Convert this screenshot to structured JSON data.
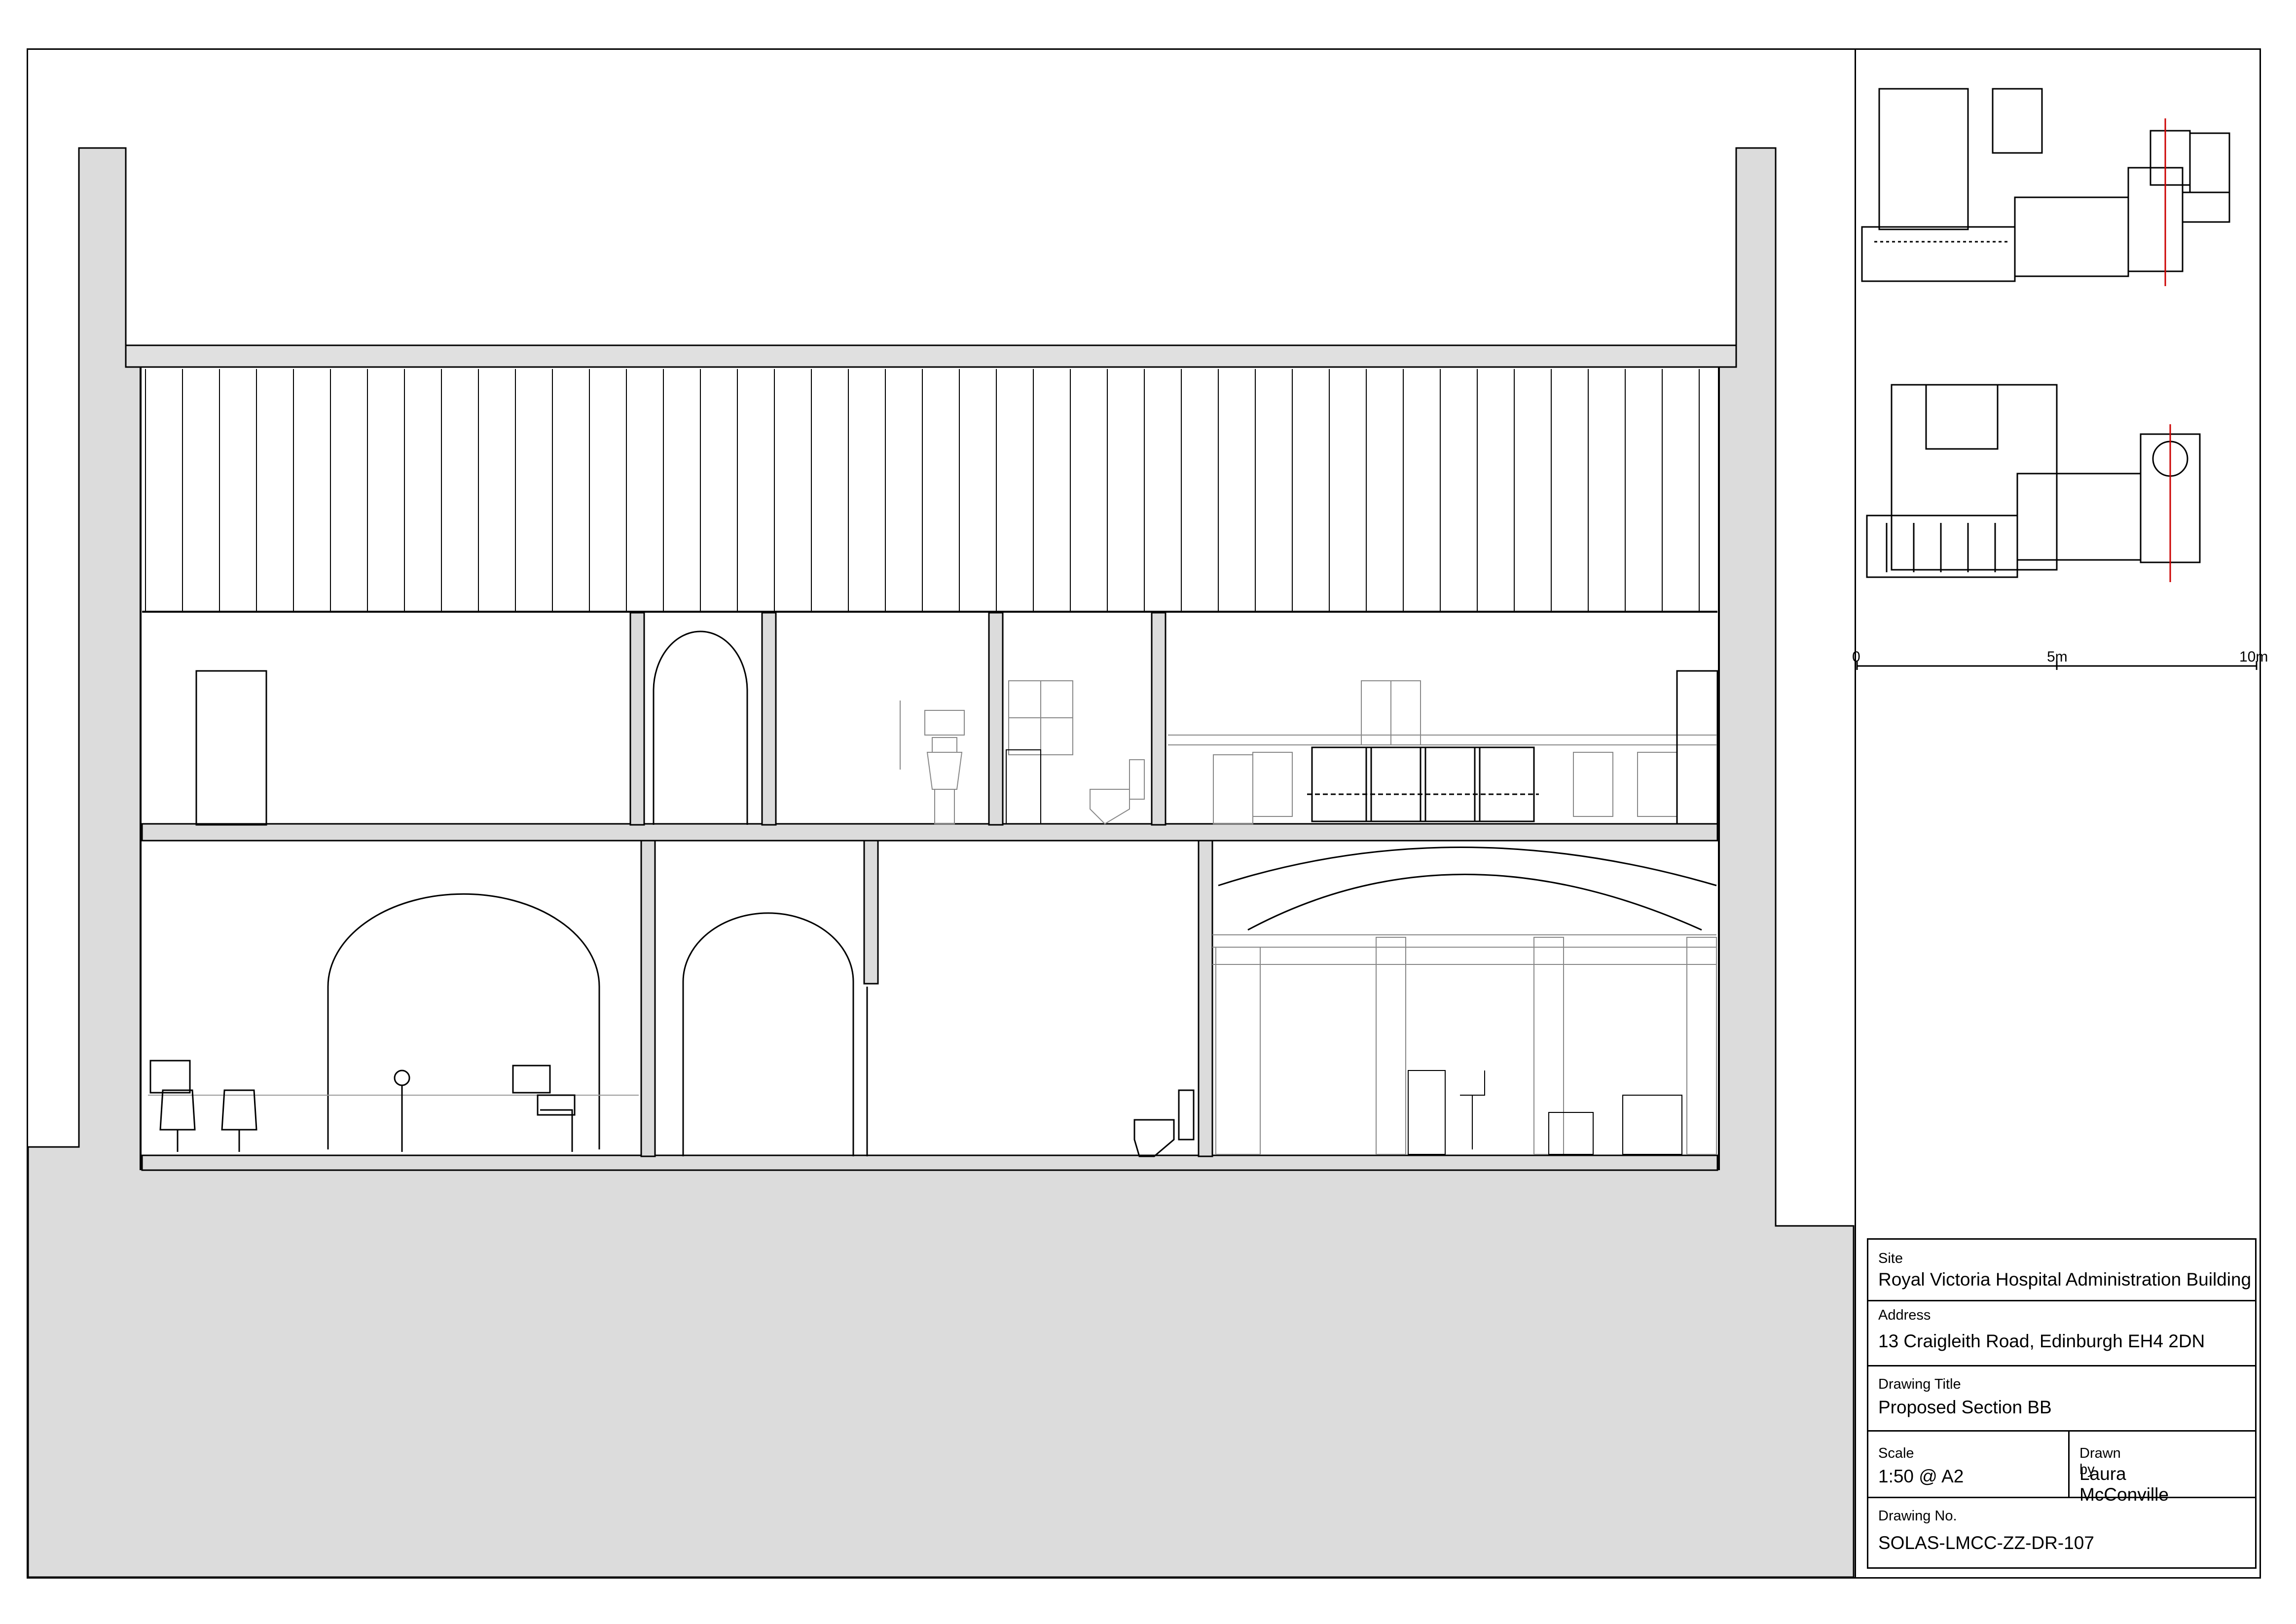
{
  "scale_bar": {
    "start": "0",
    "mid": "5m",
    "end": "10m"
  },
  "title_block": {
    "site_label": "Site",
    "site_value": "Royal Victoria Hospital Administration Building",
    "address_label": "Address",
    "address_value": "13 Craigleith Road, Edinburgh EH4 2DN",
    "drawing_title_label": "Drawing Title",
    "drawing_title_value": "Proposed Section BB",
    "scale_label": "Scale",
    "scale_value": "1:50 @ A2",
    "drawn_by_label": "Drawn by",
    "drawn_by_value": "Laura McConville",
    "drawing_no_label": "Drawing No.",
    "drawing_no_value": "SOLAS-LMCC-ZZ-DR-107"
  }
}
